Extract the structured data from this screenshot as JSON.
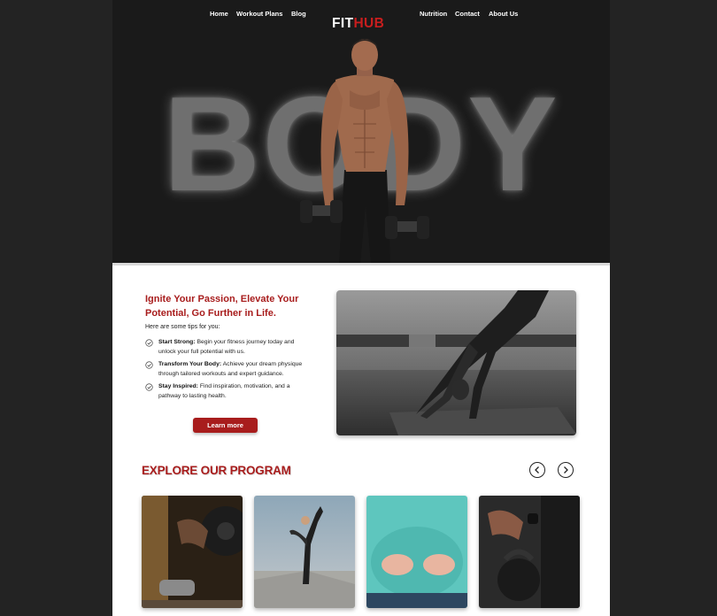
{
  "nav": {
    "left": [
      "Home",
      "Workout Plans",
      "Blog"
    ],
    "logo_fit": "FIT",
    "logo_hub": "HUB",
    "right": [
      "Nutrition",
      "Contact",
      "About Us"
    ]
  },
  "hero": {
    "word": "BODY"
  },
  "intro_section": {
    "headline": "Ignite Your Passion, Elevate Your Potential, Go Further in Life.",
    "lead": "Here are some tips for you:",
    "tips": [
      {
        "title": "Start Strong:",
        "text": "Begin your fitness journey today and unlock your full potential with us."
      },
      {
        "title": "Transform Your Body:",
        "text": "Achieve your dream physique through tailored workouts and expert guidance."
      },
      {
        "title": "Stay Inspired:",
        "text": "Find inspiration, motivation, and a pathway to lasting health."
      }
    ],
    "button": "Learn more"
  },
  "program": {
    "title": "EXPLORE OUR PROGRAM",
    "prev_icon": "chevron-left-icon",
    "next_icon": "chevron-right-icon"
  },
  "colors": {
    "accent": "#a81d1d",
    "logo_accent": "#c81e1e",
    "hero_bg": "#1a1a1a",
    "outer_bg": "#232323"
  }
}
